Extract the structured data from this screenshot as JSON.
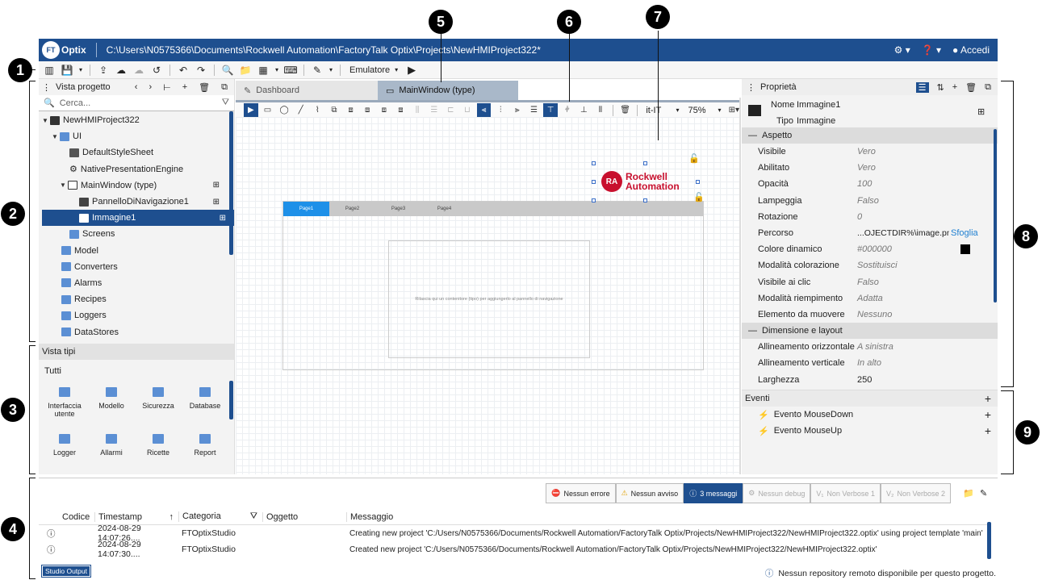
{
  "window": {
    "logo_text": "FT",
    "app_name": "Optix",
    "path": "C:\\Users\\N0575366\\Documents\\Rockwell Automation\\FactoryTalk Optix\\Projects\\NewHMIProject322*",
    "login_label": "Accedi"
  },
  "toolbar": {
    "emulator_label": "Emulatore"
  },
  "callouts": [
    "1",
    "2",
    "3",
    "4",
    "5",
    "6",
    "7",
    "8",
    "9"
  ],
  "project_view": {
    "title": "Vista progetto",
    "search_placeholder": "Cerca...",
    "tree": [
      {
        "label": "NewHMIProject322",
        "level": 0
      },
      {
        "label": "UI",
        "level": 1
      },
      {
        "label": "DefaultStyleSheet",
        "level": 2
      },
      {
        "label": "NativePresentationEngine",
        "level": 2
      },
      {
        "label": "MainWindow (type)",
        "level": 2
      },
      {
        "label": "PannelloDiNavigazione1",
        "level": 3
      },
      {
        "label": "Immagine1",
        "level": 3
      },
      {
        "label": "Screens",
        "level": 2
      },
      {
        "label": "Model",
        "level": 1
      },
      {
        "label": "Converters",
        "level": 1
      },
      {
        "label": "Alarms",
        "level": 1
      },
      {
        "label": "Recipes",
        "level": 1
      },
      {
        "label": "Loggers",
        "level": 1
      },
      {
        "label": "DataStores",
        "level": 1
      }
    ]
  },
  "types_view": {
    "title": "Vista tipi",
    "filter": "Tutti",
    "items": [
      {
        "label": "Interfaccia utente"
      },
      {
        "label": "Modello"
      },
      {
        "label": "Sicurezza"
      },
      {
        "label": "Database"
      },
      {
        "label": "Logger"
      },
      {
        "label": "Allarmi"
      },
      {
        "label": "Ricette"
      },
      {
        "label": "Report"
      }
    ]
  },
  "editor": {
    "tabs": [
      {
        "label": "Dashboard",
        "active": false
      },
      {
        "label": "MainWindow (type)",
        "active": true
      }
    ],
    "locale": "it-IT",
    "zoom": "75%",
    "nav_pages": [
      "Page1",
      "Page2",
      "Page3",
      "Page4"
    ],
    "drop_hint": "Rilascia qui un contenitore (tipo) per aggiungerlo al pannello di navigazione",
    "logo_line1": "Rockwell",
    "logo_line2": "Automation",
    "logo_badge": "RA",
    "brand_color": "#c8102e"
  },
  "properties": {
    "title": "Proprietà",
    "name_label": "Nome",
    "name_value": "Immagine1",
    "type_label": "Tipo",
    "type_value": "Immagine",
    "section_aspect": "Aspetto",
    "rows_aspect": [
      {
        "k": "Visibile",
        "v": "Vero"
      },
      {
        "k": "Abilitato",
        "v": "Vero"
      },
      {
        "k": "Opacità",
        "v": "100"
      },
      {
        "k": "Lampeggia",
        "v": "Falso"
      },
      {
        "k": "Rotazione",
        "v": "0"
      },
      {
        "k": "Percorso",
        "v": "...OJECTDIR%\\image.png"
      },
      {
        "k": "Colore dinamico",
        "v": "#000000"
      },
      {
        "k": "Modalità colorazione",
        "v": "Sostituisci"
      },
      {
        "k": "Visibile ai clic",
        "v": "Falso"
      },
      {
        "k": "Modalità riempimento",
        "v": "Adatta"
      },
      {
        "k": "Elemento da muovere",
        "v": "Nessuno"
      }
    ],
    "browse_label": "Sfoglia",
    "section_layout": "Dimensione e layout",
    "rows_layout": [
      {
        "k": "Allineamento orizzontale",
        "v": "A sinistra"
      },
      {
        "k": "Allineamento verticale",
        "v": "In alto"
      },
      {
        "k": "Larghezza",
        "v": "250"
      }
    ]
  },
  "events": {
    "title": "Eventi",
    "items": [
      "Evento MouseDown",
      "Evento MouseUp"
    ]
  },
  "output": {
    "filters": [
      {
        "label": "Nessun errore",
        "state": "normal"
      },
      {
        "label": "Nessun avviso",
        "state": "normal"
      },
      {
        "label": "3 messaggi",
        "state": "on"
      },
      {
        "label": "Nessun debug",
        "state": "dis"
      },
      {
        "label": "Non Verbose 1",
        "state": "dis"
      },
      {
        "label": "Non Verbose 2",
        "state": "dis"
      }
    ],
    "columns": [
      "Codice",
      "Timestamp",
      "Categoria",
      "Oggetto",
      "Messaggio"
    ],
    "rows": [
      {
        "timestamp": "2024-08-29 14:07:26....",
        "category": "FTOptixStudio",
        "message": "Creating new project 'C:/Users/N0575366/Documents/Rockwell Automation/FactoryTalk Optix/Projects/NewHMIProject322/NewHMIProject322.optix' using project template 'main'"
      },
      {
        "timestamp": "2024-08-29 14:07:30....",
        "category": "FTOptixStudio",
        "message": "Created new project 'C:/Users/N0575366/Documents/Rockwell Automation/FactoryTalk Optix/Projects/NewHMIProject322/NewHMIProject322.optix'"
      }
    ],
    "tab_label": "Studio Output",
    "status": "Nessun repository remoto disponibile per questo progetto."
  }
}
